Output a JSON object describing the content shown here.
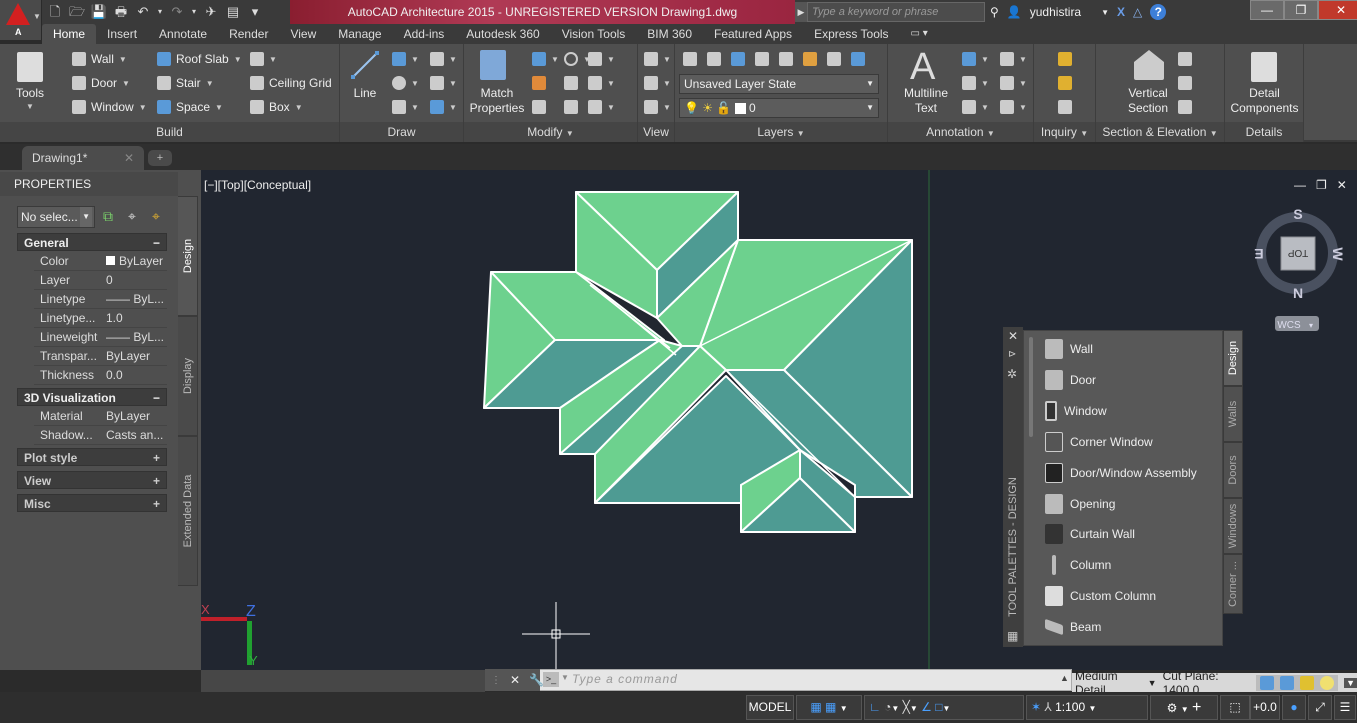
{
  "window": {
    "title": "AutoCAD Architecture 2015 - UNREGISTERED VERSION    Drawing1.dwg",
    "app_letter": "A",
    "search_placeholder": "Type a keyword or phrase",
    "user": "yudhistira"
  },
  "ribbon_tabs": [
    "Home",
    "Insert",
    "Annotate",
    "Render",
    "View",
    "Manage",
    "Add-ins",
    "Autodesk 360",
    "Vision Tools",
    "BIM 360",
    "Featured Apps",
    "Express Tools"
  ],
  "ribbon": {
    "build": {
      "title": "Build",
      "tools": "Tools",
      "wall": "Wall",
      "door": "Door",
      "window": "Window",
      "roof_slab": "Roof Slab",
      "stair": "Stair",
      "space": "Space",
      "ceiling_grid": "Ceiling Grid",
      "box": "Box"
    },
    "draw": {
      "title": "Draw",
      "line": "Line"
    },
    "modify": {
      "title": "Modify",
      "match_properties_1": "Match",
      "match_properties_2": "Properties"
    },
    "view": {
      "title": "View"
    },
    "layers": {
      "title": "Layers",
      "layer_state": "Unsaved Layer State",
      "current_layer": "0"
    },
    "annotation": {
      "title": "Annotation",
      "mtext_1": "Multiline",
      "mtext_2": "Text"
    },
    "inquiry": {
      "title": "Inquiry"
    },
    "section": {
      "title": "Section & Elevation",
      "vs_1": "Vertical",
      "vs_2": "Section"
    },
    "details": {
      "title": "Details",
      "dc_1": "Detail",
      "dc_2": "Components"
    }
  },
  "doc_tab": {
    "name": "Drawing1*"
  },
  "properties": {
    "header": "PROPERTIES",
    "selection": "No selec...",
    "general": {
      "title": "General",
      "rows": [
        {
          "k": "Color",
          "v": "ByLayer"
        },
        {
          "k": "Layer",
          "v": "0"
        },
        {
          "k": "Linetype",
          "v": "—— ByL..."
        },
        {
          "k": "Linetype...",
          "v": "1.0"
        },
        {
          "k": "Lineweight",
          "v": "—— ByL..."
        },
        {
          "k": "Transpar...",
          "v": "ByLayer"
        },
        {
          "k": "Thickness",
          "v": "0.0"
        }
      ]
    },
    "viz": {
      "title": "3D Visualization",
      "rows": [
        {
          "k": "Material",
          "v": "ByLayer"
        },
        {
          "k": "Shadow...",
          "v": "Casts an..."
        }
      ]
    },
    "collapsed": [
      "Plot style",
      "View",
      "Misc"
    ],
    "vtabs": [
      "Design",
      "Display",
      "Extended Data"
    ]
  },
  "viewport": {
    "label": "[−][Top][Conceptual]",
    "viewcube": {
      "top": "TOP",
      "n": "N",
      "s": "S",
      "e": "E",
      "w": "W",
      "wcs": "WCS"
    },
    "ucs": {
      "x": "X",
      "y": "Y",
      "z": "Z"
    },
    "colors": {
      "roof_light": "#6dd18e",
      "roof_dark": "#4e9b93",
      "background": "#212630"
    }
  },
  "tool_palette": {
    "title": "TOOL PALETTES - DESIGN",
    "items": [
      "Wall",
      "Door",
      "Window",
      "Corner Window",
      "Door/Window Assembly",
      "Opening",
      "Curtain Wall",
      "Column",
      "Custom Column",
      "Beam"
    ],
    "tabs": [
      "Design",
      "Walls",
      "Doors",
      "Windows",
      "Corner ..."
    ]
  },
  "command": {
    "placeholder": "Type a command"
  },
  "detail_bar": {
    "level": "Medium Detail",
    "cut_plane": "Cut Plane: 1400.0"
  },
  "status": {
    "model": "MODEL",
    "scale": "1:100",
    "elevation": "+0.0"
  }
}
